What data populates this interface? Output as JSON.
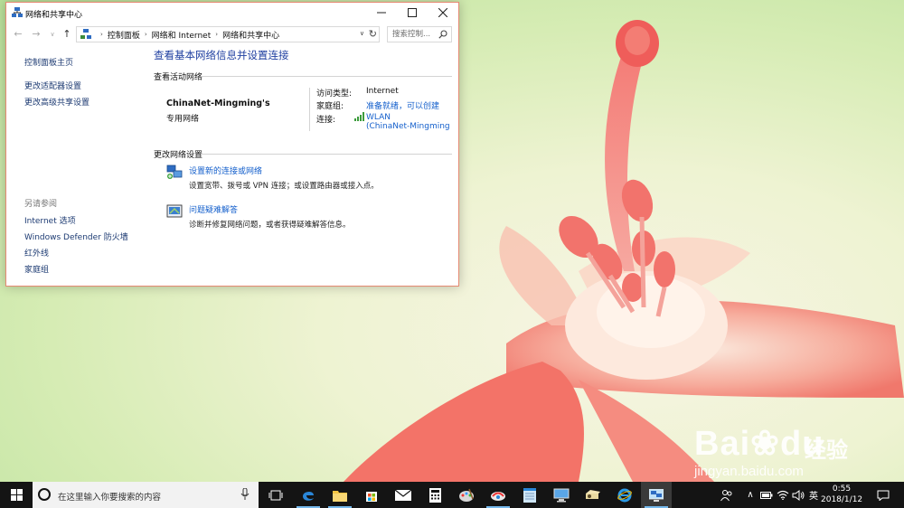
{
  "window": {
    "title": "网络和共享中心",
    "search_placeholder": "搜索控制...",
    "breadcrumb": [
      "控制面板",
      "网络和 Internet",
      "网络和共享中心"
    ]
  },
  "left_pane": {
    "links": [
      "控制面板主页",
      "更改适配器设置",
      "更改高级共享设置"
    ],
    "see_also_heading": "另请参阅",
    "see_also_links": [
      "Internet 选项",
      "Windows Defender 防火墙",
      "红外线",
      "家庭组"
    ]
  },
  "main": {
    "title": "查看基本网络信息并设置连接",
    "active_networks_heading": "查看活动网络",
    "network_name": "ChinaNet-Mingming's",
    "network_type": "专用网络",
    "access_type_label": "访问类型:",
    "access_type_value": "Internet",
    "homegroup_label": "家庭组:",
    "homegroup_value": "准备就绪，可以创建",
    "connections_label": "连接:",
    "connection_line1": "WLAN",
    "connection_line2": "(ChinaNet-Mingming",
    "change_settings_heading": "更改网络设置",
    "tasks": [
      {
        "link": "设置新的连接或网络",
        "desc": "设置宽带、拨号或 VPN 连接；或设置路由器或接入点。"
      },
      {
        "link": "问题疑难解答",
        "desc": "诊断并修复网络问题，或者获得疑难解答信息。"
      }
    ]
  },
  "taskbar": {
    "search_placeholder": "在这里输入你要搜索的内容",
    "ime": "英",
    "time": "0:55",
    "date": "2018/1/12"
  },
  "watermark": {
    "logo": "Bai",
    "logo2": "du",
    "cn": "经验",
    "url": "jingyan.baidu.com"
  },
  "colors": {
    "accent": "#1560cc",
    "window_border": "#e58a73",
    "taskbar": "#141414"
  }
}
